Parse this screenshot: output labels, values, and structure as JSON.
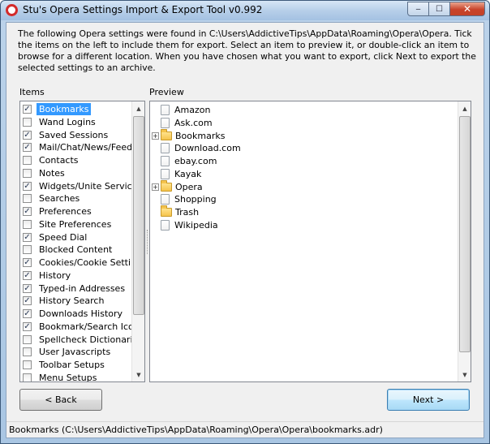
{
  "window": {
    "title": "Stu's Opera Settings Import & Export Tool v0.992",
    "controls": {
      "minimize": "‒",
      "maximize": "☐",
      "close": "✕"
    }
  },
  "intro_text": "The following Opera settings were found in C:\\Users\\AddictiveTips\\AppData\\Roaming\\Opera\\Opera. Tick the items on the left to include them for export. Select an item to preview it, or double-click an item to browse for a different location. When you have chosen what you want to export, click Next to export the selected settings to an archive.",
  "items_label": "Items",
  "preview_label": "Preview",
  "items": [
    {
      "label": "Bookmarks",
      "checked": true,
      "selected": true
    },
    {
      "label": "Wand Logins",
      "checked": false
    },
    {
      "label": "Saved Sessions",
      "checked": true
    },
    {
      "label": "Mail/Chat/News/Feeds",
      "checked": true
    },
    {
      "label": "Contacts",
      "checked": false
    },
    {
      "label": "Notes",
      "checked": false
    },
    {
      "label": "Widgets/Unite Services",
      "checked": true
    },
    {
      "label": "Searches",
      "checked": false
    },
    {
      "label": "Preferences",
      "checked": true
    },
    {
      "label": "Site Preferences",
      "checked": false
    },
    {
      "label": "Speed Dial",
      "checked": true
    },
    {
      "label": "Blocked Content",
      "checked": false
    },
    {
      "label": "Cookies/Cookie Settings",
      "checked": true
    },
    {
      "label": "History",
      "checked": true
    },
    {
      "label": "Typed-in Addresses",
      "checked": true
    },
    {
      "label": "History Search",
      "checked": true
    },
    {
      "label": "Downloads History",
      "checked": true
    },
    {
      "label": "Bookmark/Search Icons",
      "checked": true
    },
    {
      "label": "Spellcheck Dictionaries",
      "checked": false
    },
    {
      "label": "User Javascripts",
      "checked": false
    },
    {
      "label": "Toolbar Setups",
      "checked": false
    },
    {
      "label": "Menu Setups",
      "checked": false
    }
  ],
  "preview_tree": [
    {
      "label": "Amazon",
      "type": "page",
      "expandable": false
    },
    {
      "label": "Ask.com",
      "type": "page",
      "expandable": false
    },
    {
      "label": "Bookmarks",
      "type": "folder",
      "expandable": true
    },
    {
      "label": "Download.com",
      "type": "page",
      "expandable": false
    },
    {
      "label": "ebay.com",
      "type": "page",
      "expandable": false
    },
    {
      "label": "Kayak",
      "type": "page",
      "expandable": false
    },
    {
      "label": "Opera",
      "type": "folder",
      "expandable": true
    },
    {
      "label": "Shopping",
      "type": "page",
      "expandable": false
    },
    {
      "label": "Trash",
      "type": "folder",
      "expandable": false
    },
    {
      "label": "Wikipedia",
      "type": "page",
      "expandable": false
    }
  ],
  "buttons": {
    "back": "< Back",
    "next": "Next >"
  },
  "status": "Bookmarks (C:\\Users\\AddictiveTips\\AppData\\Roaming\\Opera\\Opera\\bookmarks.adr)"
}
